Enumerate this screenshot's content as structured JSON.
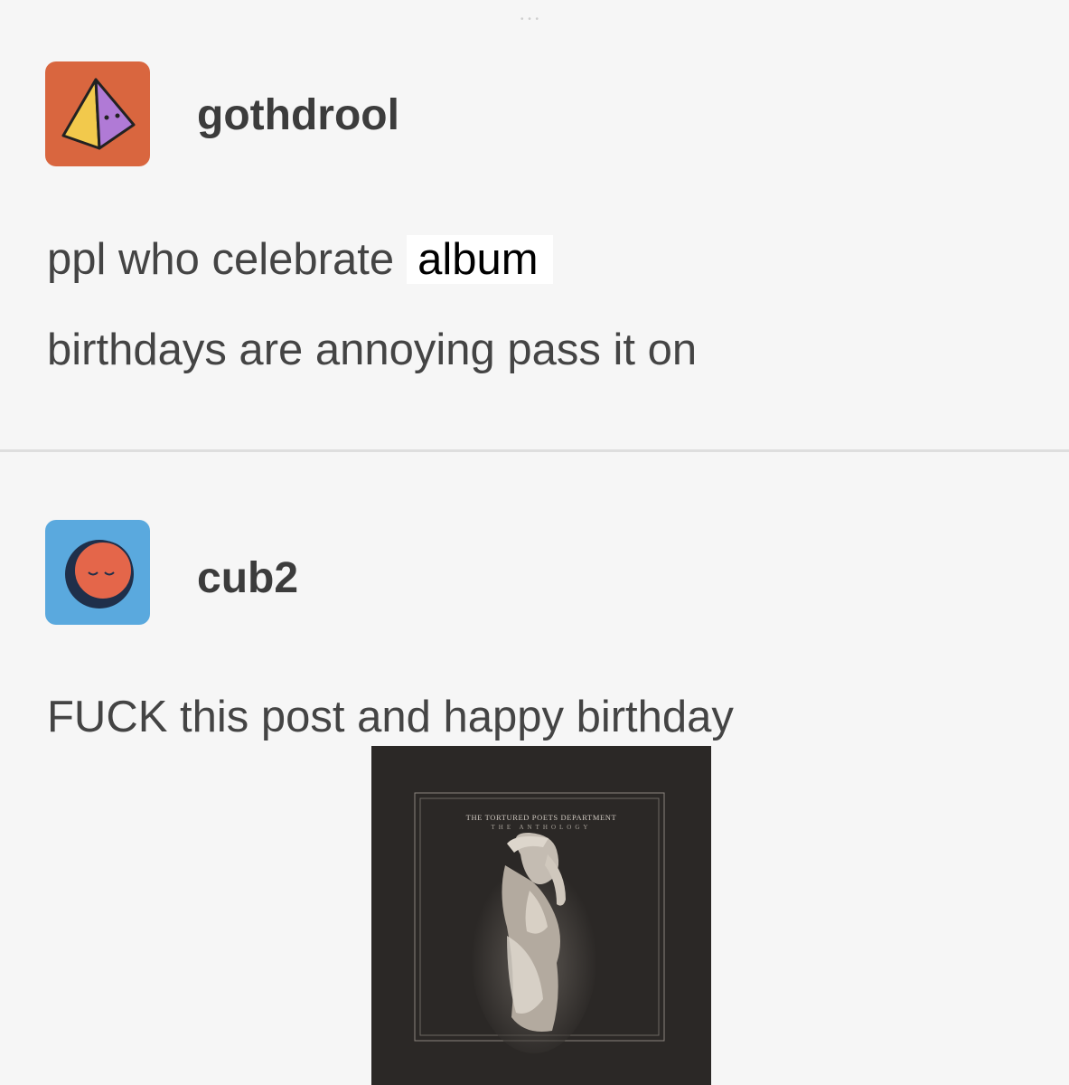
{
  "post_1": {
    "username": "gothdrool",
    "text_line_1": "ppl who celebrate",
    "text_overlay_word": "album",
    "text_line_2": "birthdays are annoying pass it on",
    "avatar_icon": "pyramid-icon",
    "avatar_color": "#d9663f"
  },
  "post_2": {
    "username": "cub2",
    "text_line_1": "FUCK this post and happy birthday",
    "avatar_icon": "sleeping-face-icon",
    "avatar_color": "#5aa9de"
  },
  "album_cover": {
    "title": "THE TORTURED POETS DEPARTMENT",
    "subtitle": "THE ANTHOLOGY"
  }
}
